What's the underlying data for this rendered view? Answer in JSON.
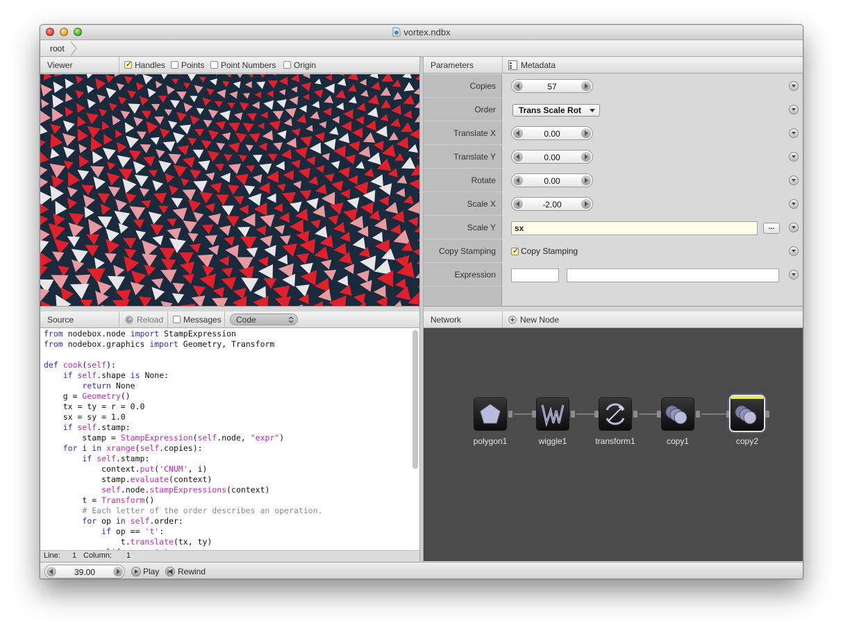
{
  "window": {
    "title": "vortex.ndbx"
  },
  "path": {
    "root_label": "root"
  },
  "viewer": {
    "header": "Viewer",
    "handles_label": "Handles",
    "points_label": "Points",
    "point_numbers_label": "Point Numbers",
    "origin_label": "Origin"
  },
  "parameters": {
    "header": "Parameters",
    "metadata_label": "Metadata",
    "copies": {
      "label": "Copies",
      "value": "57"
    },
    "order": {
      "label": "Order",
      "value": "Trans Scale Rot"
    },
    "translate_x": {
      "label": "Translate X",
      "value": "0.00"
    },
    "translate_y": {
      "label": "Translate Y",
      "value": "0.00"
    },
    "rotate": {
      "label": "Rotate",
      "value": "0.00"
    },
    "scale_x": {
      "label": "Scale X",
      "value": "-2.00"
    },
    "scale_y": {
      "label": "Scale Y",
      "value": "sx",
      "button": "..."
    },
    "copy_stamping": {
      "label": "Copy Stamping",
      "checkbox_label": "Copy Stamping"
    },
    "expression": {
      "label": "Expression",
      "value1": "",
      "value2": ""
    }
  },
  "source": {
    "header": "Source",
    "reload_label": "Reload",
    "messages_label": "Messages",
    "mode_value": "Code",
    "status_line_label": "Line:",
    "status_line_value": "1",
    "status_column_label": "Column:",
    "status_column_value": "1"
  },
  "network": {
    "header": "Network",
    "new_node_label": "New Node",
    "nodes": [
      {
        "name": "polygon1"
      },
      {
        "name": "wiggle1"
      },
      {
        "name": "transform1"
      },
      {
        "name": "copy1"
      },
      {
        "name": "copy2"
      }
    ]
  },
  "transport": {
    "frame_value": "39.00",
    "play_label": "Play",
    "rewind_label": "Rewind"
  },
  "colors": {
    "viewer_background": "#182a3c",
    "triangle_red": "#e2202b",
    "triangle_pink": "#e89aa0",
    "triangle_white": "#e9e6e8",
    "network_background": "#4b4b4b",
    "selected_node_bar": "#ecef3d"
  }
}
